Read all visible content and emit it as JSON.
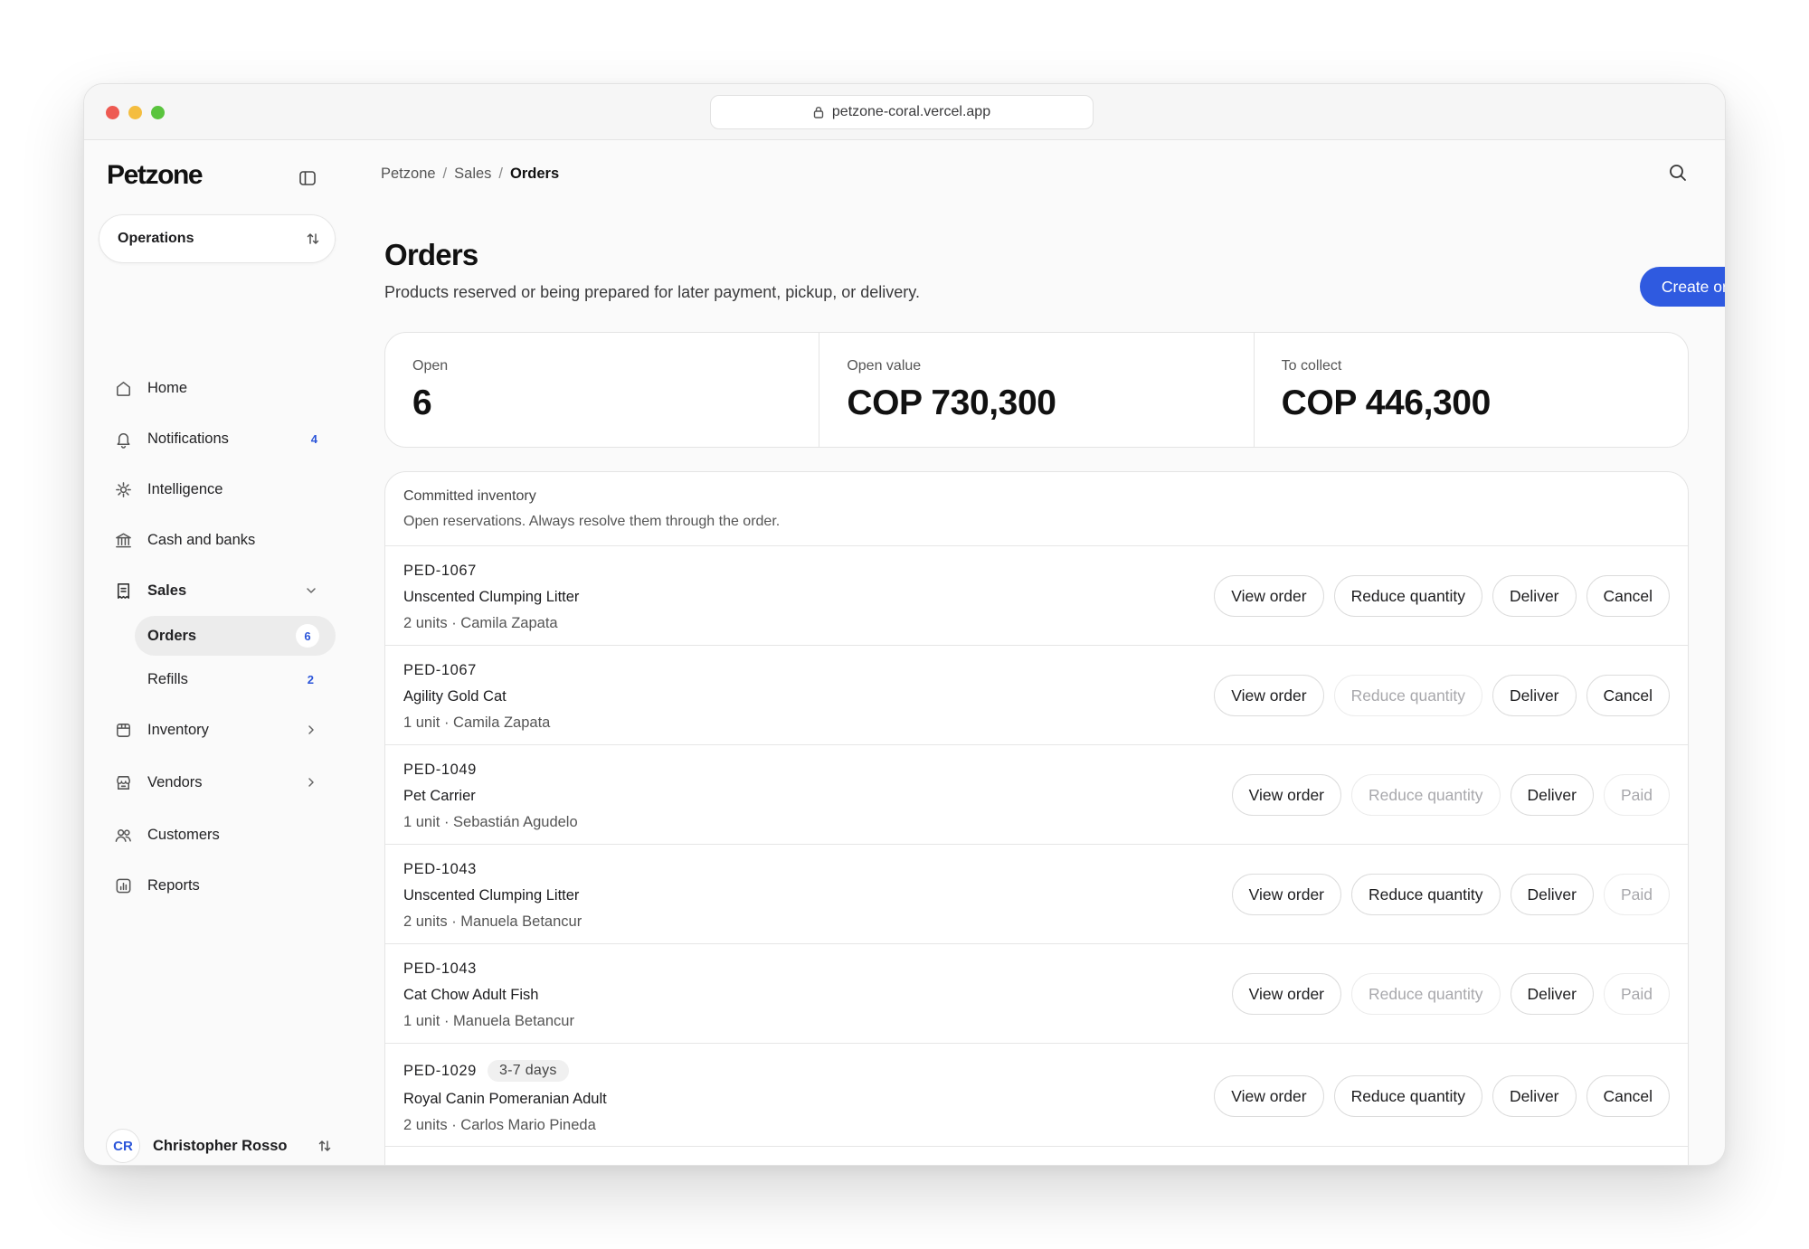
{
  "browser": {
    "url": "petzone-coral.vercel.app"
  },
  "sidebar": {
    "logo": "Petzone",
    "workspace": "Operations",
    "items": [
      {
        "label": "Home",
        "icon": "home-icon"
      },
      {
        "label": "Notifications",
        "icon": "bell-icon",
        "badge": "4"
      },
      {
        "label": "Intelligence",
        "icon": "sparkle-icon"
      },
      {
        "label": "Cash and banks",
        "icon": "bank-icon"
      },
      {
        "label": "Sales",
        "icon": "receipt-icon"
      },
      {
        "label": "Inventory",
        "icon": "box-icon"
      },
      {
        "label": "Vendors",
        "icon": "store-icon"
      },
      {
        "label": "Customers",
        "icon": "users-icon"
      },
      {
        "label": "Reports",
        "icon": "chart-icon"
      }
    ],
    "sales_sub": [
      {
        "label": "Orders",
        "badge": "6"
      },
      {
        "label": "Refills",
        "badge": "2"
      }
    ],
    "user": {
      "initials": "CR",
      "name": "Christopher Rosso"
    }
  },
  "breadcrumb": [
    "Petzone",
    "Sales",
    "Orders"
  ],
  "page": {
    "title": "Orders",
    "subtitle": "Products reserved or being prepared for later payment, pickup, or delivery.",
    "create_button": "Create order"
  },
  "stats": [
    {
      "label": "Open",
      "value": "6"
    },
    {
      "label": "Open value",
      "value": "COP 730,300"
    },
    {
      "label": "To collect",
      "value": "COP 446,300"
    }
  ],
  "inventory": {
    "title": "Committed inventory",
    "description": "Open reservations. Always resolve them through the order.",
    "rows": [
      {
        "code": "PED-1067",
        "product": "Unscented Clumping Litter",
        "meta": "2 units · Camila Zapata",
        "view": "View order",
        "reduce": "Reduce quantity",
        "deliver": "Deliver",
        "last": "Cancel"
      },
      {
        "code": "PED-1067",
        "product": "Agility Gold Cat",
        "meta": "1 unit · Camila Zapata",
        "view": "View order",
        "reduce": "Reduce quantity",
        "deliver": "Deliver",
        "last": "Cancel"
      },
      {
        "code": "PED-1049",
        "product": "Pet Carrier",
        "meta": "1 unit · Sebastián Agudelo",
        "view": "View order",
        "reduce": "Reduce quantity",
        "deliver": "Deliver",
        "last": "Paid"
      },
      {
        "code": "PED-1043",
        "product": "Unscented Clumping Litter",
        "meta": "2 units · Manuela Betancur",
        "view": "View order",
        "reduce": "Reduce quantity",
        "deliver": "Deliver",
        "last": "Paid"
      },
      {
        "code": "PED-1043",
        "product": "Cat Chow Adult Fish",
        "meta": "1 unit · Manuela Betancur",
        "view": "View order",
        "reduce": "Reduce quantity",
        "deliver": "Deliver",
        "last": "Paid"
      },
      {
        "code": "PED-1029",
        "tag": "3-7 days",
        "product": "Royal Canin Pomeranian Adult",
        "meta": "2 units · Carlos Mario Pineda",
        "view": "View order",
        "reduce": "Reduce quantity",
        "deliver": "Deliver",
        "last": "Cancel"
      }
    ]
  },
  "colors": {
    "accent": "#2f5ae0",
    "badge": "#2b55d9",
    "disabled_text": "#a8a8ac"
  }
}
